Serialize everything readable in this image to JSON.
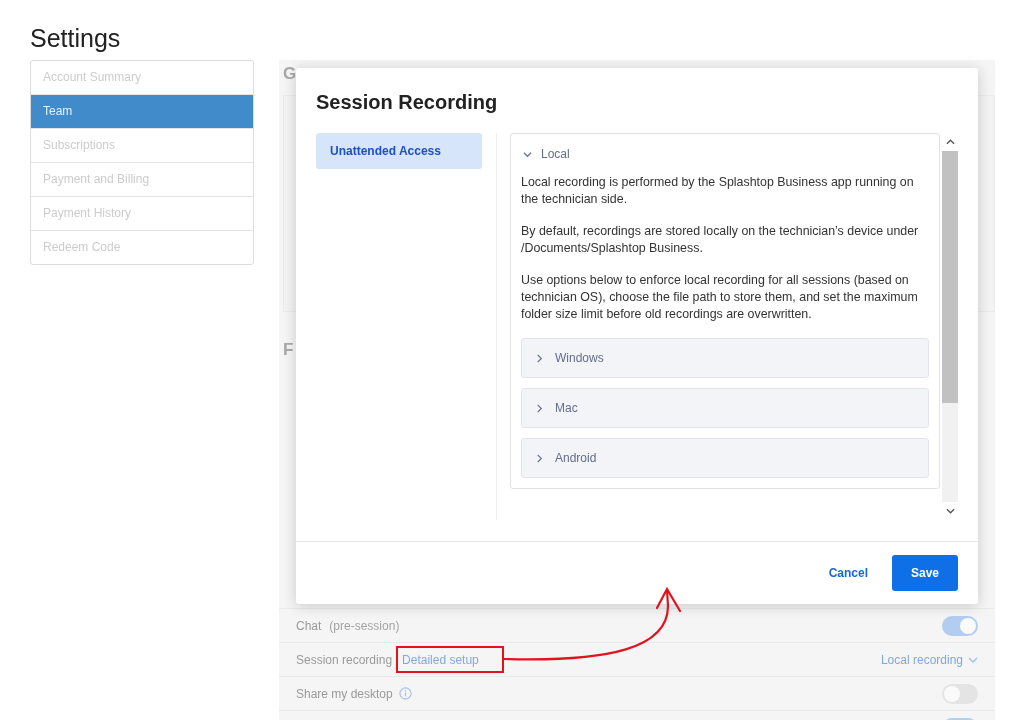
{
  "page_title": "Settings",
  "sidebar": {
    "items": [
      {
        "label": "Account Summary",
        "selected": false
      },
      {
        "label": "Team",
        "selected": true
      },
      {
        "label": "Subscriptions",
        "selected": false
      },
      {
        "label": "Payment and Billing",
        "selected": false
      },
      {
        "label": "Payment History",
        "selected": false
      },
      {
        "label": "Redeem Code",
        "selected": false
      }
    ]
  },
  "background": {
    "headings": [
      "G",
      "F"
    ],
    "rows": [
      {
        "kind": "toggle",
        "label": "Chat",
        "note": "(pre-session)",
        "on": true
      },
      {
        "kind": "select",
        "label": "Session recording",
        "link": "Detailed setup",
        "value": "Local recording"
      },
      {
        "kind": "toggle",
        "label": "Share my desktop",
        "info": true,
        "on": false
      },
      {
        "kind": "toggle",
        "on": true
      }
    ]
  },
  "modal": {
    "title": "Session Recording",
    "nav": [
      {
        "label": "Unattended Access",
        "selected": true
      }
    ],
    "section": {
      "title": "Local",
      "expanded": true,
      "paragraphs": [
        "Local recording is performed by the Splashtop Business app running on the technician side.",
        "By default, recordings are stored locally on the technician’s device under /Documents/Splashtop Business.",
        "Use options below to enforce local recording for all sessions (based on technician OS), choose the file path to store them, and set the maximum folder size limit before old recordings are overwritten."
      ],
      "subsections": [
        {
          "title": "Windows",
          "expanded": false
        },
        {
          "title": "Mac",
          "expanded": false
        },
        {
          "title": "Android",
          "expanded": false
        }
      ]
    },
    "buttons": {
      "cancel": "Cancel",
      "save": "Save"
    }
  }
}
